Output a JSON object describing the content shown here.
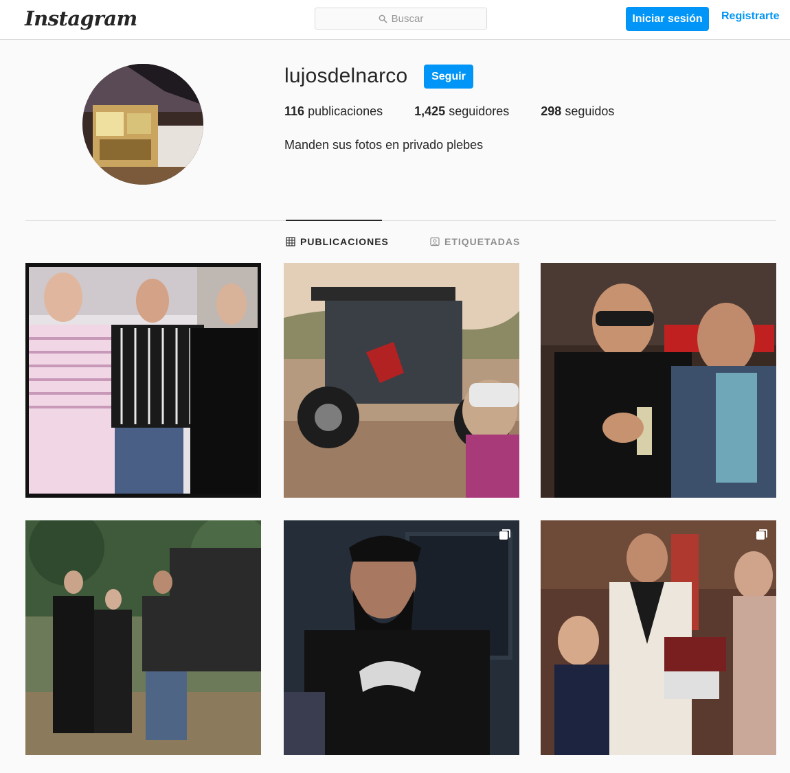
{
  "nav": {
    "logo_text": "Instagram",
    "search": {
      "placeholder": "Buscar",
      "icon": "search-icon"
    },
    "login_label": "Iniciar sesión",
    "register_label": "Registrarte"
  },
  "profile": {
    "username": "lujosdelnarco",
    "follow_label": "Seguir",
    "stats": [
      {
        "count": "116",
        "label": "publicaciones"
      },
      {
        "count": "1,425",
        "label": "seguidores"
      },
      {
        "count": "298",
        "label": "seguidos"
      }
    ],
    "bio": "Manden sus fotos en privado plebes"
  },
  "tabs": [
    {
      "label": "PUBLICACIONES",
      "icon": "grid-icon",
      "active": true
    },
    {
      "label": "ETIQUETADAS",
      "icon": "tagged-icon",
      "active": false
    }
  ],
  "posts": [
    {
      "multi": false
    },
    {
      "multi": false
    },
    {
      "multi": false
    },
    {
      "multi": false
    },
    {
      "multi": true
    },
    {
      "multi": true
    }
  ],
  "colors": {
    "accent": "#0095f6",
    "text": "#262626",
    "muted": "#8e8e8e",
    "border": "#dbdbdb",
    "background": "#fafafa"
  }
}
